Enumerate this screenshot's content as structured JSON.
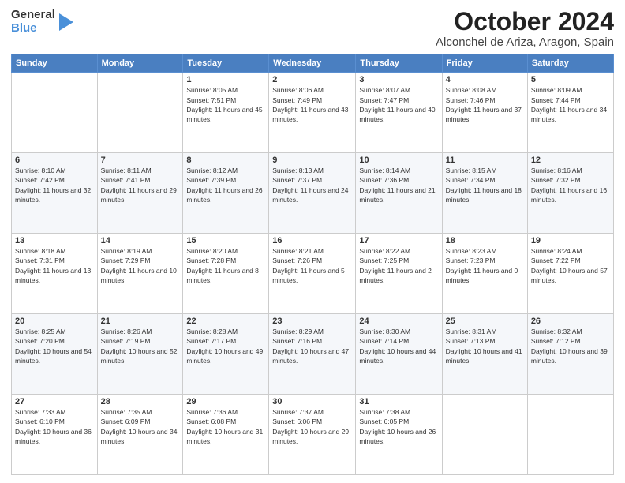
{
  "header": {
    "logo_general": "General",
    "logo_blue": "Blue",
    "month_title": "October 2024",
    "location": "Alconchel de Ariza, Aragon, Spain"
  },
  "days_of_week": [
    "Sunday",
    "Monday",
    "Tuesday",
    "Wednesday",
    "Thursday",
    "Friday",
    "Saturday"
  ],
  "weeks": [
    [
      {
        "day": "",
        "info": ""
      },
      {
        "day": "",
        "info": ""
      },
      {
        "day": "1",
        "info": "Sunrise: 8:05 AM\nSunset: 7:51 PM\nDaylight: 11 hours and 45 minutes."
      },
      {
        "day": "2",
        "info": "Sunrise: 8:06 AM\nSunset: 7:49 PM\nDaylight: 11 hours and 43 minutes."
      },
      {
        "day": "3",
        "info": "Sunrise: 8:07 AM\nSunset: 7:47 PM\nDaylight: 11 hours and 40 minutes."
      },
      {
        "day": "4",
        "info": "Sunrise: 8:08 AM\nSunset: 7:46 PM\nDaylight: 11 hours and 37 minutes."
      },
      {
        "day": "5",
        "info": "Sunrise: 8:09 AM\nSunset: 7:44 PM\nDaylight: 11 hours and 34 minutes."
      }
    ],
    [
      {
        "day": "6",
        "info": "Sunrise: 8:10 AM\nSunset: 7:42 PM\nDaylight: 11 hours and 32 minutes."
      },
      {
        "day": "7",
        "info": "Sunrise: 8:11 AM\nSunset: 7:41 PM\nDaylight: 11 hours and 29 minutes."
      },
      {
        "day": "8",
        "info": "Sunrise: 8:12 AM\nSunset: 7:39 PM\nDaylight: 11 hours and 26 minutes."
      },
      {
        "day": "9",
        "info": "Sunrise: 8:13 AM\nSunset: 7:37 PM\nDaylight: 11 hours and 24 minutes."
      },
      {
        "day": "10",
        "info": "Sunrise: 8:14 AM\nSunset: 7:36 PM\nDaylight: 11 hours and 21 minutes."
      },
      {
        "day": "11",
        "info": "Sunrise: 8:15 AM\nSunset: 7:34 PM\nDaylight: 11 hours and 18 minutes."
      },
      {
        "day": "12",
        "info": "Sunrise: 8:16 AM\nSunset: 7:32 PM\nDaylight: 11 hours and 16 minutes."
      }
    ],
    [
      {
        "day": "13",
        "info": "Sunrise: 8:18 AM\nSunset: 7:31 PM\nDaylight: 11 hours and 13 minutes."
      },
      {
        "day": "14",
        "info": "Sunrise: 8:19 AM\nSunset: 7:29 PM\nDaylight: 11 hours and 10 minutes."
      },
      {
        "day": "15",
        "info": "Sunrise: 8:20 AM\nSunset: 7:28 PM\nDaylight: 11 hours and 8 minutes."
      },
      {
        "day": "16",
        "info": "Sunrise: 8:21 AM\nSunset: 7:26 PM\nDaylight: 11 hours and 5 minutes."
      },
      {
        "day": "17",
        "info": "Sunrise: 8:22 AM\nSunset: 7:25 PM\nDaylight: 11 hours and 2 minutes."
      },
      {
        "day": "18",
        "info": "Sunrise: 8:23 AM\nSunset: 7:23 PM\nDaylight: 11 hours and 0 minutes."
      },
      {
        "day": "19",
        "info": "Sunrise: 8:24 AM\nSunset: 7:22 PM\nDaylight: 10 hours and 57 minutes."
      }
    ],
    [
      {
        "day": "20",
        "info": "Sunrise: 8:25 AM\nSunset: 7:20 PM\nDaylight: 10 hours and 54 minutes."
      },
      {
        "day": "21",
        "info": "Sunrise: 8:26 AM\nSunset: 7:19 PM\nDaylight: 10 hours and 52 minutes."
      },
      {
        "day": "22",
        "info": "Sunrise: 8:28 AM\nSunset: 7:17 PM\nDaylight: 10 hours and 49 minutes."
      },
      {
        "day": "23",
        "info": "Sunrise: 8:29 AM\nSunset: 7:16 PM\nDaylight: 10 hours and 47 minutes."
      },
      {
        "day": "24",
        "info": "Sunrise: 8:30 AM\nSunset: 7:14 PM\nDaylight: 10 hours and 44 minutes."
      },
      {
        "day": "25",
        "info": "Sunrise: 8:31 AM\nSunset: 7:13 PM\nDaylight: 10 hours and 41 minutes."
      },
      {
        "day": "26",
        "info": "Sunrise: 8:32 AM\nSunset: 7:12 PM\nDaylight: 10 hours and 39 minutes."
      }
    ],
    [
      {
        "day": "27",
        "info": "Sunrise: 7:33 AM\nSunset: 6:10 PM\nDaylight: 10 hours and 36 minutes."
      },
      {
        "day": "28",
        "info": "Sunrise: 7:35 AM\nSunset: 6:09 PM\nDaylight: 10 hours and 34 minutes."
      },
      {
        "day": "29",
        "info": "Sunrise: 7:36 AM\nSunset: 6:08 PM\nDaylight: 10 hours and 31 minutes."
      },
      {
        "day": "30",
        "info": "Sunrise: 7:37 AM\nSunset: 6:06 PM\nDaylight: 10 hours and 29 minutes."
      },
      {
        "day": "31",
        "info": "Sunrise: 7:38 AM\nSunset: 6:05 PM\nDaylight: 10 hours and 26 minutes."
      },
      {
        "day": "",
        "info": ""
      },
      {
        "day": "",
        "info": ""
      }
    ]
  ]
}
